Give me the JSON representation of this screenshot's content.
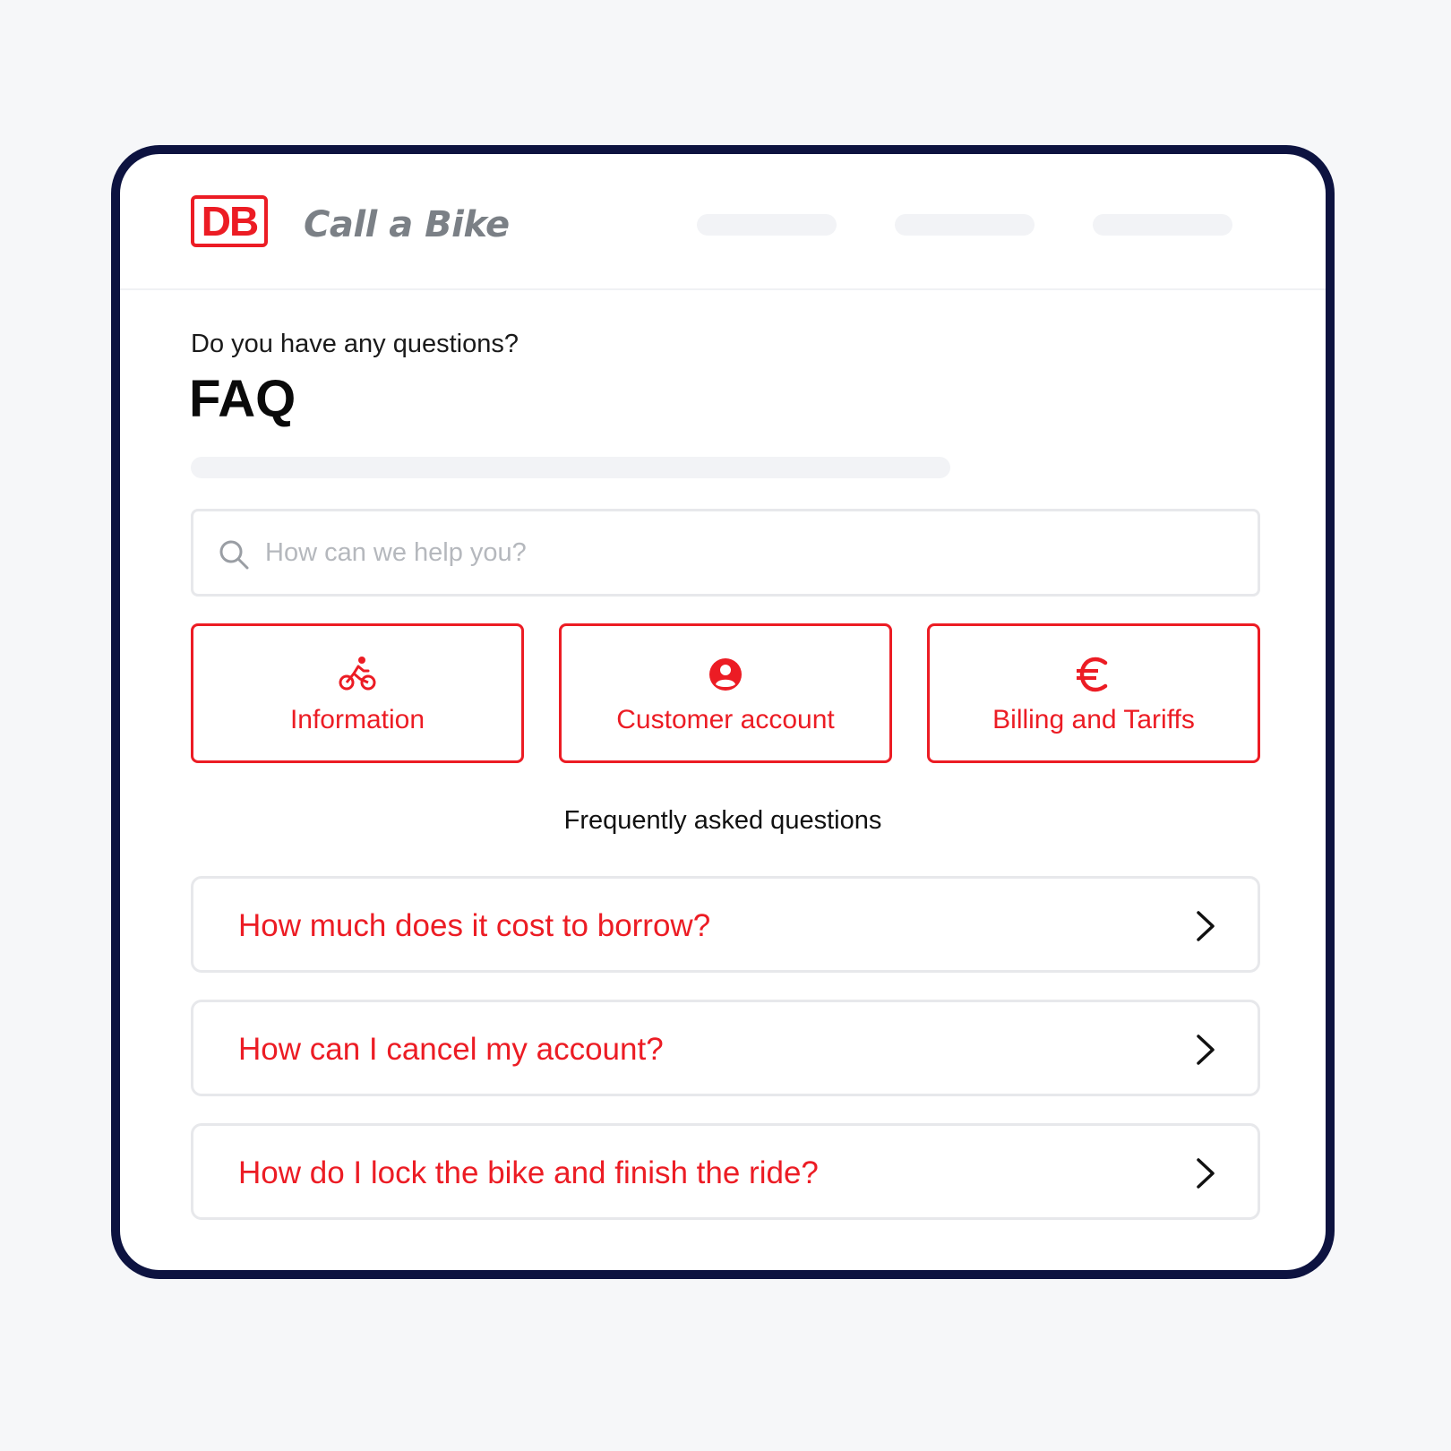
{
  "colors": {
    "brand_red": "#ec1c24",
    "frame": "#0d1340",
    "background": "#f6f7f9",
    "muted_gray": "#7b8086",
    "border_gray": "#e7e8eb"
  },
  "header": {
    "logo_text": "DB",
    "app_name": "Call a Bike",
    "nav_placeholders": 3
  },
  "intro": {
    "eyebrow": "Do you have any questions?",
    "title": "FAQ"
  },
  "search": {
    "placeholder": "How can we help you?",
    "value": "",
    "icon": "search-icon"
  },
  "categories": [
    {
      "label": "Information",
      "icon": "bicycle-rider-icon"
    },
    {
      "label": "Customer account",
      "icon": "user-circle-icon"
    },
    {
      "label": "Billing and Tariffs",
      "icon": "euro-icon"
    }
  ],
  "faq": {
    "section_label": "Frequently asked questions",
    "items": [
      {
        "question": "How much does it cost to borrow?",
        "icon": "chevron-right-icon"
      },
      {
        "question": "How can I cancel my account?",
        "icon": "chevron-right-icon"
      },
      {
        "question": "How do I lock the bike and finish the ride?",
        "icon": "chevron-right-icon"
      }
    ]
  }
}
